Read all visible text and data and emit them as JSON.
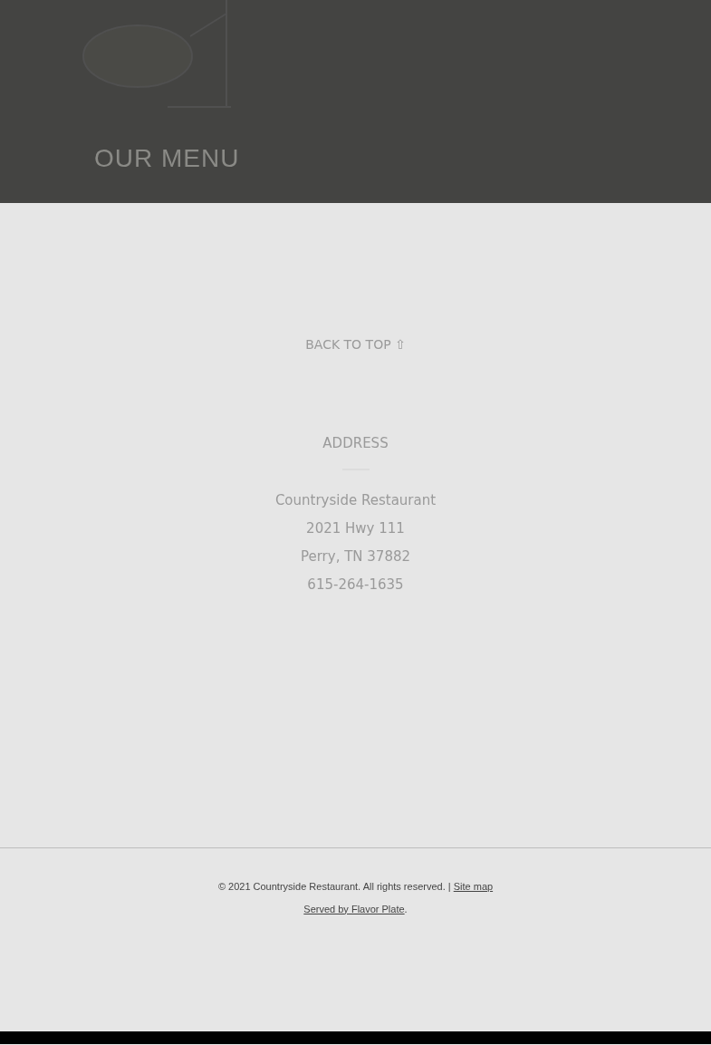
{
  "header": {
    "title": "OUR MENU"
  },
  "back_to_top": "BACK TO TOP ⇧",
  "address": {
    "heading": "ADDRESS",
    "lines": [
      "Countryside Restaurant",
      "2021 Hwy 111",
      "Perry, TN 37882",
      "615-264-1635"
    ]
  },
  "footer": {
    "copyright": "© 2021 Countryside Restaurant. All rights reserved.",
    "separator": "|",
    "sitemap_link": "Site map",
    "credit_link": "Served by Flavor Plate",
    "credit_end": "."
  }
}
